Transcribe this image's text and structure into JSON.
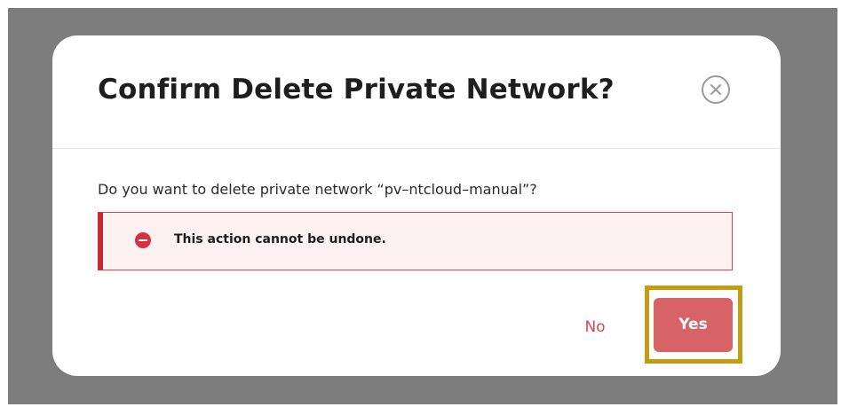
{
  "dialog": {
    "title": "Confirm Delete Private Network?",
    "message": "Do you want to delete private network “pv–ntcloud–manual”?",
    "alert": {
      "text": "This action cannot be undone.",
      "icon": "error-minus-circle-icon",
      "color": "#d6323f"
    },
    "buttons": {
      "no_label": "No",
      "yes_label": "Yes"
    },
    "close_icon": "close-circle-icon"
  },
  "colors": {
    "overlay": "#7d7d7d",
    "danger": "#d86367",
    "highlight": "#c29d12"
  }
}
